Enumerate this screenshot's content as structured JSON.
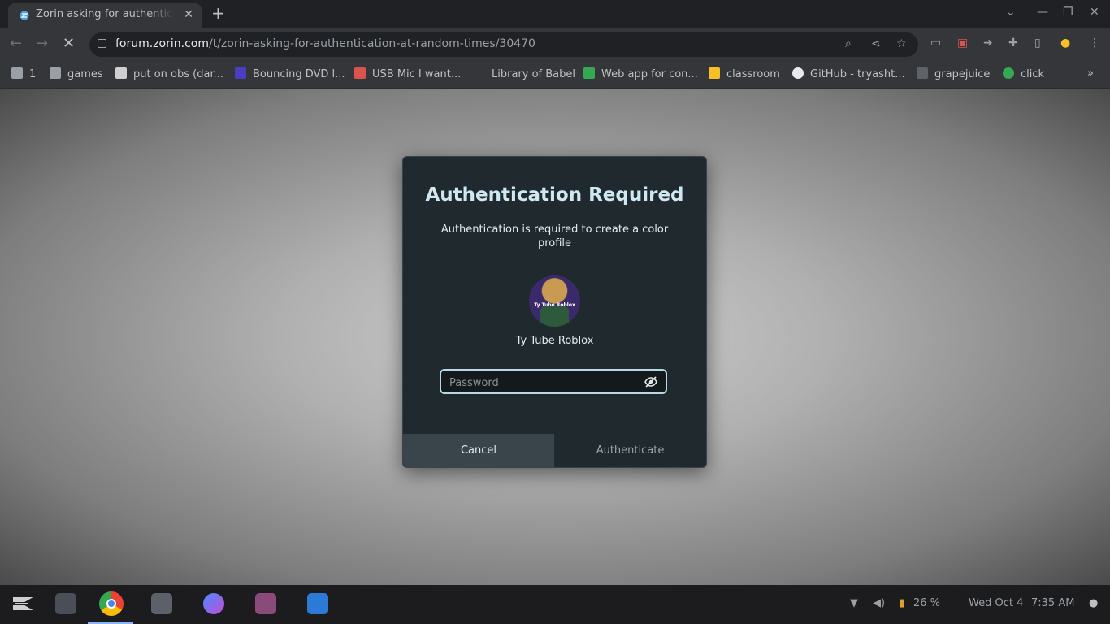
{
  "browser": {
    "tab_title": "Zorin asking for authentication at random times",
    "url_host": "forum.zorin.com",
    "url_path": "/t/zorin-asking-for-authentication-at-random-times/30470",
    "bookmarks": [
      {
        "label": "1",
        "color": "#9aa0a6"
      },
      {
        "label": "games",
        "color": "#9aa0a6"
      },
      {
        "label": "put on obs (dar...",
        "color": "#cfcfcf"
      },
      {
        "label": "Bouncing DVD l...",
        "color": "#4b3fbf"
      },
      {
        "label": "USB Mic I want...",
        "color": "#d9534f"
      },
      {
        "label": "Library of Babel",
        "color": "#35363a"
      },
      {
        "label": "Web app for con...",
        "color": "#34a853"
      },
      {
        "label": "classroom",
        "color": "#f6c026"
      },
      {
        "label": "GitHub - tryasht...",
        "color": "#e8eaed"
      },
      {
        "label": "grapejuice",
        "color": "#5f6368"
      },
      {
        "label": "click",
        "color": "#34a853"
      }
    ]
  },
  "dialog": {
    "title": "Authentication Required",
    "message": "Authentication is required to create a color profile",
    "avatar_caption": "Ty Tube Roblox",
    "username": "Ty Tube Roblox",
    "password_placeholder": "Password",
    "password_value": "",
    "cancel_label": "Cancel",
    "authenticate_label": "Authenticate"
  },
  "taskbar": {
    "apps": [
      "zorin-menu-icon",
      "workspaces-icon",
      "chrome-icon",
      "files-icon",
      "messenger-icon",
      "video-icon",
      "software-store-icon"
    ],
    "battery": "26 %",
    "date": "Wed Oct 4",
    "time": "7:35 AM"
  },
  "colors": {
    "dialog_bg": "#202a2e",
    "accent": "#b8d8e6",
    "cancel_bg": "#39454b"
  }
}
